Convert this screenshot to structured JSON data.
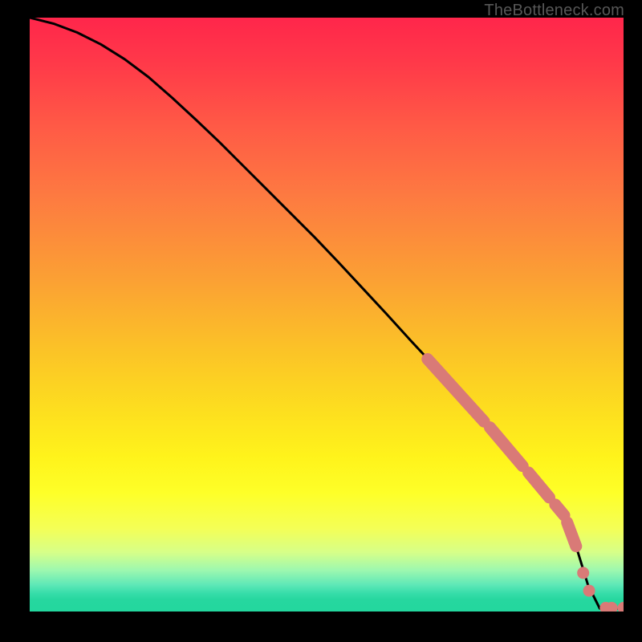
{
  "attribution": "TheBottleneck.com",
  "chart_data": {
    "type": "line",
    "title": "",
    "xlabel": "",
    "ylabel": "",
    "xlim": [
      0,
      100
    ],
    "ylim": [
      0,
      100
    ],
    "curve": {
      "x": [
        0,
        4,
        8,
        12,
        16,
        20,
        24,
        28,
        32,
        36,
        40,
        44,
        48,
        52,
        56,
        60,
        64,
        68,
        72,
        76,
        80,
        84,
        88,
        90,
        92,
        94,
        96,
        98,
        100
      ],
      "y": [
        100,
        99,
        97.5,
        95.5,
        93,
        90,
        86.5,
        82.8,
        79,
        75,
        71,
        67,
        63,
        58.8,
        54.5,
        50.2,
        45.8,
        41.5,
        37,
        32.6,
        28,
        23.4,
        18.6,
        16.2,
        11,
        4.5,
        0.5,
        0.5,
        0.5
      ]
    },
    "highlight_segments": [
      {
        "x": [
          67,
          76.5
        ],
        "y": [
          42.5,
          32
        ]
      },
      {
        "x": [
          77.5,
          83
        ],
        "y": [
          31,
          24.5
        ]
      },
      {
        "x": [
          84,
          87.5
        ],
        "y": [
          23.4,
          19.2
        ]
      },
      {
        "x": [
          88.5,
          90
        ],
        "y": [
          18,
          16.2
        ]
      },
      {
        "x": [
          90.5,
          92
        ],
        "y": [
          15,
          11
        ]
      }
    ],
    "highlight_dots": [
      {
        "x": 93.2,
        "y": 6.5
      },
      {
        "x": 94.2,
        "y": 3.5
      },
      {
        "x": 97,
        "y": 0.6
      },
      {
        "x": 98,
        "y": 0.6
      },
      {
        "x": 100,
        "y": 0.6
      }
    ]
  }
}
